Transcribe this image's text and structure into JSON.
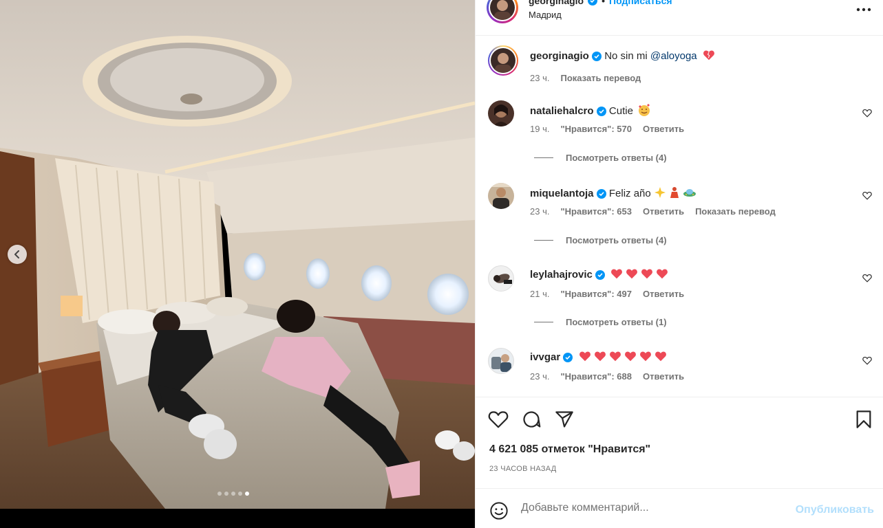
{
  "post": {
    "username": "georginagio",
    "follow_label": "Подписаться",
    "location": "Мадрид",
    "more_icon": "more-horizontal-icon",
    "media_dots": 5,
    "media_active_dot": 5
  },
  "caption": {
    "username": "georginagio",
    "text": "No sin mi",
    "mention": "@aloyoga",
    "time": "23 ч.",
    "translate_label": "Показать перевод"
  },
  "comments": [
    {
      "username": "nataliehalcro",
      "text": "Cutie",
      "emoji": "smiling-face-with-hearts",
      "time": "19 ч.",
      "likes": "\"Нравится\": 570",
      "reply": "Ответить",
      "view_replies": "Посмотреть ответы (4)"
    },
    {
      "username": "miquelantoja",
      "text": "Feliz año",
      "emoji": "sparkles-dancer-flying-saucer",
      "time": "23 ч.",
      "likes": "\"Нравится\": 653",
      "reply": "Ответить",
      "translate": "Показать перевод",
      "view_replies": "Посмотреть ответы (4)"
    },
    {
      "username": "leylahajrovic",
      "text": "",
      "hearts": 4,
      "time": "21 ч.",
      "likes": "\"Нравится\": 497",
      "reply": "Ответить",
      "view_replies": "Посмотреть ответы (1)"
    },
    {
      "username": "ivvgar",
      "text": "",
      "hearts": 6,
      "time": "23 ч.",
      "likes": "\"Нравится\": 688",
      "reply": "Ответить"
    }
  ],
  "actions": {
    "likes_text": "4 621 085 отметок \"Нравится\"",
    "time_ago": "23 ЧАСОВ НАЗАД"
  },
  "add_comment": {
    "placeholder": "Добавьте комментарий...",
    "publish_label": "Опубликовать"
  },
  "colors": {
    "accent": "#0095f6",
    "publish_disabled": "#b2dffc",
    "heart_red": "#ed4956",
    "secondary_text": "#737373"
  }
}
